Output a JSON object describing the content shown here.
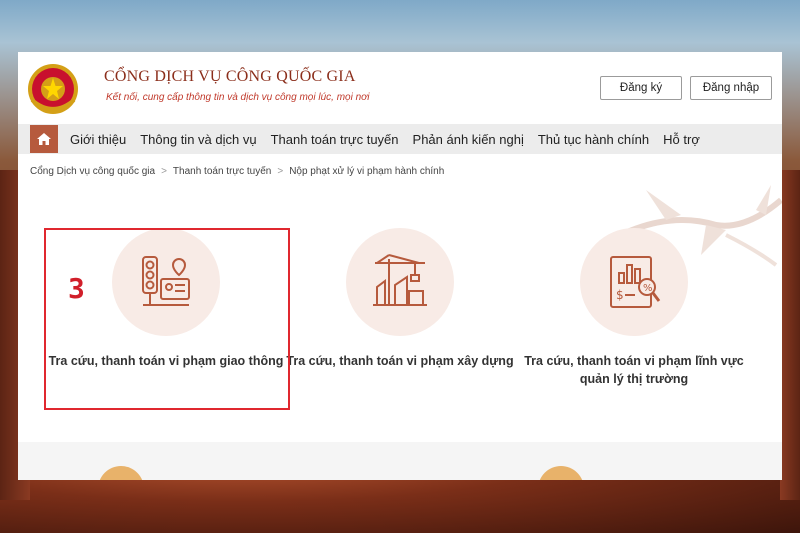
{
  "header": {
    "brand_title": "CỔNG DỊCH VỤ CÔNG QUỐC GIA",
    "brand_subtitle": "Kết nối, cung cấp thông tin và dịch vụ công mọi lúc, mọi nơi",
    "register_label": "Đăng ký",
    "login_label": "Đăng nhập"
  },
  "nav": {
    "home_icon": "home-icon",
    "items": [
      {
        "label": "Giới thiệu"
      },
      {
        "label": "Thông tin và dịch vụ"
      },
      {
        "label": "Thanh toán trực tuyến"
      },
      {
        "label": "Phản ánh kiến nghị"
      },
      {
        "label": "Thủ tục hành chính"
      },
      {
        "label": "Hỗ trợ"
      }
    ]
  },
  "breadcrumb": {
    "items": [
      {
        "label": "Cổng Dịch vụ công quốc gia"
      },
      {
        "label": "Thanh toán trực tuyến"
      },
      {
        "label": "Nộp phạt xử lý vi phạm hành chính"
      }
    ],
    "separator": ">"
  },
  "cards": [
    {
      "label": "Tra cứu, thanh toán vi phạm giao thông",
      "icon": "traffic-light-icon"
    },
    {
      "label": "Tra cứu, thanh toán vi phạm xây dựng",
      "icon": "construction-crane-icon"
    },
    {
      "label": "Tra cứu, thanh toán vi phạm lĩnh vực quản lý thị trường",
      "icon": "market-report-icon"
    }
  ],
  "annotation": {
    "step_number": "3",
    "color": "#e0282f"
  },
  "colors": {
    "brand": "#8b2e1b",
    "accent": "#b65a3d",
    "circle_bg": "#f8ebe6"
  }
}
